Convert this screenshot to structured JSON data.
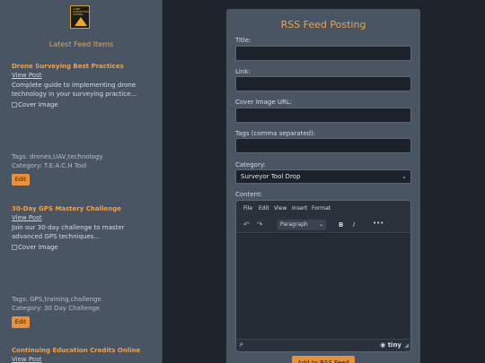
{
  "sidebar": {
    "logo_text": "LAND SURVEYORS UNITED",
    "title": "Latest Feed Items",
    "items": [
      {
        "title": "Drone Surveying Best Practices",
        "view": "View Post",
        "description": "Complete guide to implementing drone technology in your surveying practice...",
        "image_alt": "Cover Image",
        "tags": "Tags: drones,UAV,technology",
        "category": "Category: T.E.A.C.H Tool",
        "edit": "Edit"
      },
      {
        "title": "30-Day GPS Mastery Challenge",
        "view": "View Post",
        "description": "Join our 30-day challenge to master advanced GPS techniques...",
        "image_alt": "Cover Image",
        "tags": "Tags: GPS,training,challenge",
        "category": "Category: 30 Day Challenge",
        "edit": "Edit"
      },
      {
        "title": "Continuing Education Credits Online",
        "view": "View Post"
      }
    ]
  },
  "form": {
    "title": "RSS Feed Posting",
    "title_label": "Title:",
    "title_value": "",
    "link_label": "Link:",
    "link_value": "",
    "cover_label": "Cover Image URL:",
    "cover_value": "",
    "tags_label": "Tags (comma separated):",
    "tags_value": "",
    "category_label": "Category:",
    "category_value": "Surveyor Tool Drop",
    "content_label": "Content:",
    "editor": {
      "menus": [
        "File",
        "Edit",
        "View",
        "Insert",
        "Format"
      ],
      "format_value": "Paragraph",
      "status_path": "P",
      "brand": "tiny"
    },
    "submit": "Add to RSS Feed"
  },
  "colors": {
    "accent": "#f0a04b",
    "button": "#e8913a",
    "panel": "#4a5564",
    "background": "#1f232b"
  }
}
